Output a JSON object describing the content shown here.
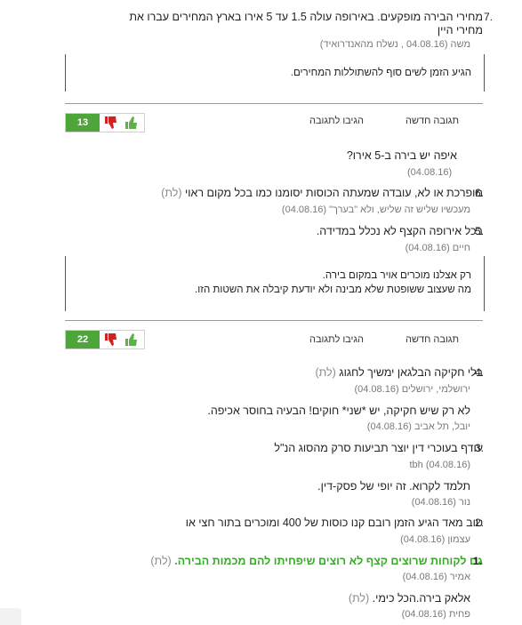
{
  "item7": {
    "number": "7.",
    "title_line1": "מחירי הבירה מופקעים. באירופה עולה 1.5 עד 5 אירו בארץ המחירים עברו את",
    "title_line2": "מחירי היין",
    "meta": "משה (04.08.16 , נשלח מהאנדרואיד)",
    "body": "הגיע הזמן לשים סוף להשתוללות המחירים.",
    "actions": {
      "new": "תגובה חדשה",
      "reply": "הגיבו לתגובה"
    },
    "score": "13",
    "reply": {
      "title": "איפה יש בירה ב-5 אירו?",
      "meta": "(04.08.16)"
    }
  },
  "item6": {
    "number": "6.",
    "title": "מופרכת או לא, עובדה שמעתה הכוסות יסומנו כמו בכל מקום ראוי",
    "tag": "(לת)",
    "meta": "מעכשיו שליש זה שליש, ולא \"בערך\" (04.08.16)"
  },
  "item5": {
    "number": "5.",
    "title": "בכל אירופה הקצף לא נכלל במדידה.",
    "meta": "חיים (04.08.16)",
    "body_line1": "רק אצלנו מוכרים אויר במקום בירה.",
    "body_line2": "מה שעצוב ששופטת שלא מבינה ולא יודעת קיבלה את השטות הזו.",
    "actions": {
      "new": "תגובה חדשה",
      "reply": "הגיבו לתגובה"
    },
    "score": "22"
  },
  "item4": {
    "number": "4.",
    "title": "בלי חקיקה הבלגאן ימשיך לחגוג",
    "tag": "(לת)",
    "meta": "ירושלמי, ירושלים (04.08.16)",
    "reply": {
      "title": "לא רק שיש חקיקה, יש *שני* חוקים! הבעיה בחוסר אכיפה.",
      "meta": "יובל, תל אביב (04.08.16)"
    }
  },
  "item3": {
    "number": "3.",
    "title": "עודף בעוכרי דין יוצר תביעות סרק מהסוג הנ\"ל",
    "meta": "tbh (04.08.16)",
    "reply": {
      "title": "תלמד לקרוא. זה יופי של פסק-דין.",
      "meta": "נור (04.08.16)"
    }
  },
  "item2": {
    "number": "2.",
    "title": "טוב מאד הגיע הזמן רובם קנו כוסות של 400 ומוכרים בתור חצי או",
    "meta": "עצמון (04.08.16)"
  },
  "item1": {
    "number": "1.",
    "title": "גם לקוחות שרוצים קצף לא רוצים שיפחיתו להם מכמות הבירה.",
    "tag": "(לת)",
    "meta": "אמיר (04.08.16)",
    "reply": {
      "title": "אלאק בירה.הכל כימי.",
      "tag": "(לת)",
      "meta": "פחית (04.08.16)"
    }
  },
  "icons": {
    "up": "thumbs-up-icon",
    "down": "thumbs-down-icon"
  },
  "colors": {
    "green": "#39a92b",
    "score_bg": "#4ea63a",
    "thumb_down": "#d42020",
    "thumb_up": "#5cb247"
  }
}
